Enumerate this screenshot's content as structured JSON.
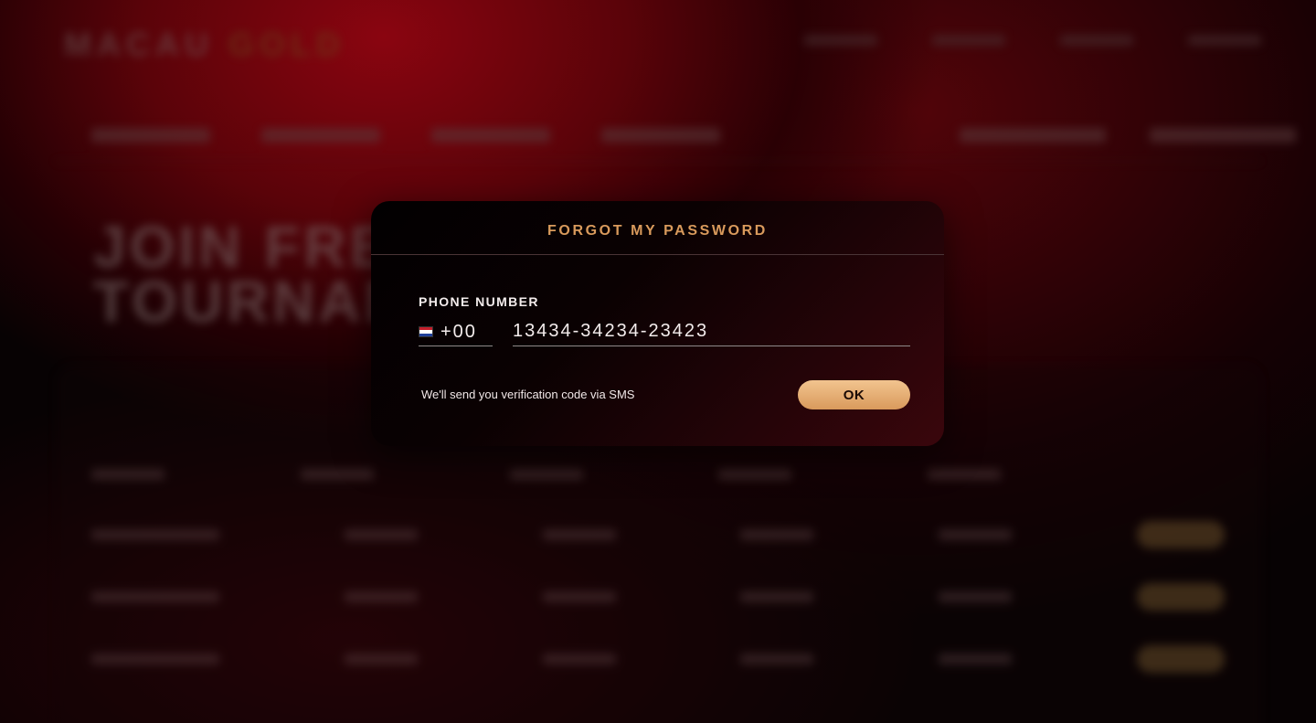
{
  "background": {
    "logo_primary": "MACAU",
    "logo_secondary": "GOLD",
    "hero_line1": "JOIN FREE",
    "hero_line2": "TOURNAMENTS"
  },
  "modal": {
    "title": "FORGOT MY PASSWORD",
    "phone_label": "PHONE NUMBER",
    "country_code": "+00",
    "country_flag": "netherlands-flag-icon",
    "phone_value": "13434-34234-23423",
    "hint": "We'll send you verification code via SMS",
    "ok_label": "OK"
  },
  "colors": {
    "accent": "#d99a5c",
    "button_gradient_top": "#f2c48f",
    "text": "#f3ecec"
  }
}
